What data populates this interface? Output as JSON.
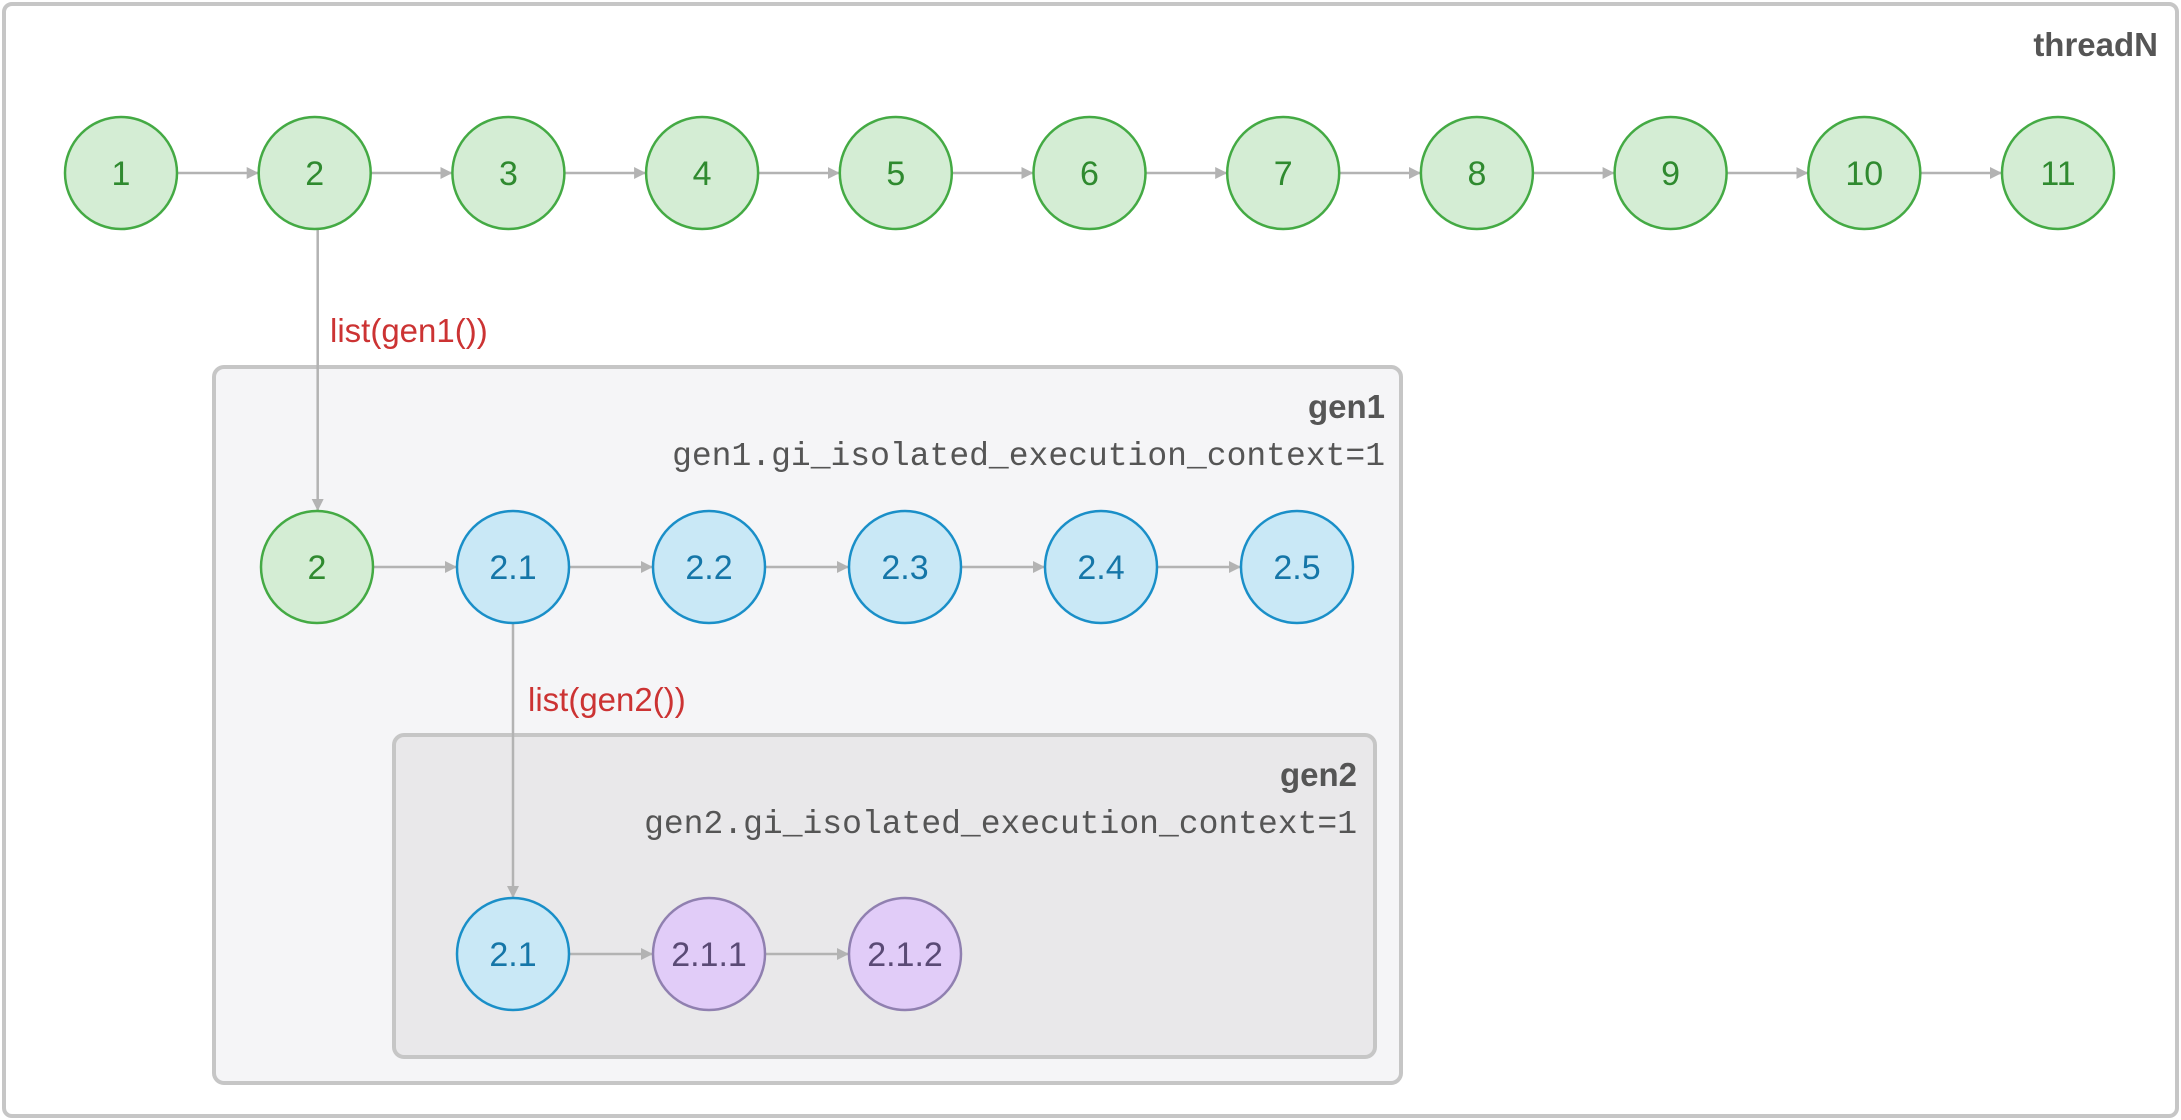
{
  "colors": {
    "green_fill": "#d4edd4",
    "green_stroke": "#44aa44",
    "green_text": "#2f8a2f",
    "blue_fill": "#c9e8f6",
    "blue_stroke": "#1a8fc8",
    "blue_text": "#1576a8",
    "purple_fill": "#e1ccf8",
    "purple_stroke": "#9080b0",
    "purple_text": "#5a4a75",
    "edge": "#b3b3b3",
    "call_label": "#cc3333"
  },
  "thread": {
    "title": "threadN",
    "nodes": [
      "1",
      "2",
      "3",
      "4",
      "5",
      "6",
      "7",
      "8",
      "9",
      "10",
      "11"
    ]
  },
  "gen1": {
    "title": "gen1",
    "context": "gen1.gi_isolated_execution_context=1",
    "call_label": "list(gen1())",
    "nodes": [
      "2",
      "2.1",
      "2.2",
      "2.3",
      "2.4",
      "2.5"
    ]
  },
  "gen2": {
    "title": "gen2",
    "context": "gen2.gi_isolated_execution_context=1",
    "call_label": "list(gen2())",
    "nodes": [
      "2.1",
      "2.1.1",
      "2.1.2"
    ]
  }
}
